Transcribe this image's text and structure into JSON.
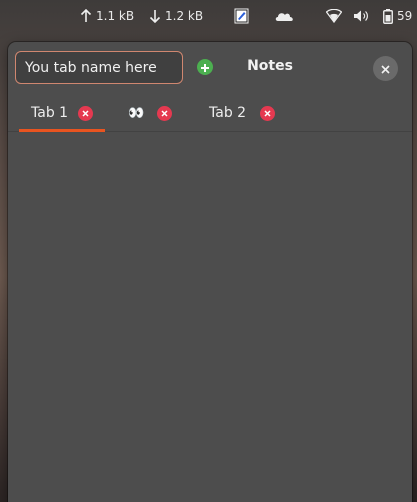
{
  "topbar": {
    "upload": "1.1 kB",
    "download": "1.2 kB",
    "battery": "59",
    "icons": [
      "arrow-up-icon",
      "arrow-down-icon",
      "notes-app-icon",
      "cloud-icon",
      "wifi-icon",
      "volume-icon",
      "battery-icon"
    ]
  },
  "header": {
    "input_placeholder": "You tab name here",
    "title": "Notes"
  },
  "tabs": [
    {
      "label": "Tab 1",
      "active": true
    },
    {
      "label": "👀",
      "active": false
    },
    {
      "label": "Tab 2",
      "active": false
    }
  ],
  "colors": {
    "accent": "#e95420",
    "input_border": "#d08770",
    "add": "#4caf50",
    "tab_close": "#e53950",
    "popup_bg": "#4d4d4d"
  }
}
